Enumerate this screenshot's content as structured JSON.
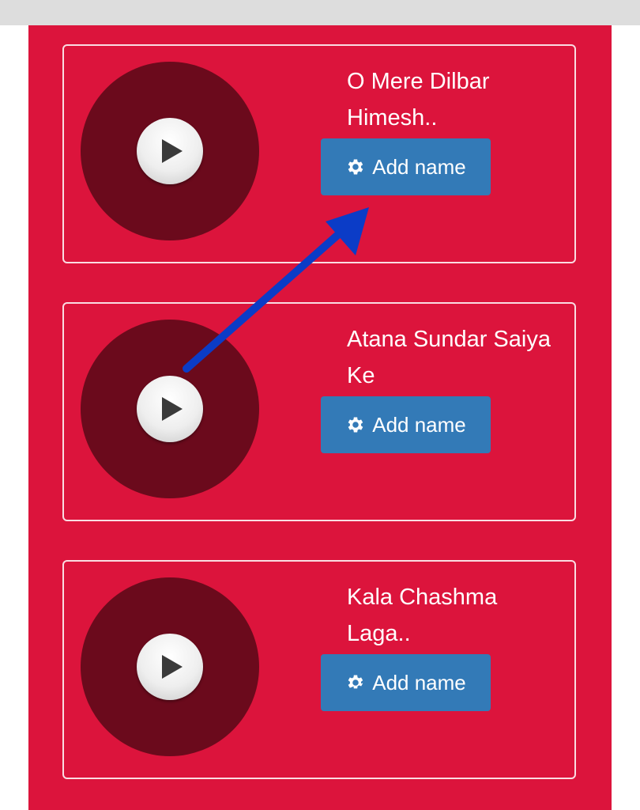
{
  "songs": [
    {
      "title": "O Mere Dilbar Himesh..",
      "button_label": "Add name"
    },
    {
      "title": "Atana Sundar Saiya Ke",
      "button_label": "Add name"
    },
    {
      "title": "Kala Chashma Laga..",
      "button_label": "Add name"
    }
  ],
  "icons": {
    "play": "play-icon",
    "settings": "gear-icon"
  },
  "colors": {
    "panel_background": "#dc143c",
    "disc": "#6b0a1c",
    "button": "#337ab7",
    "annotation_arrow": "#0b3cc7"
  }
}
